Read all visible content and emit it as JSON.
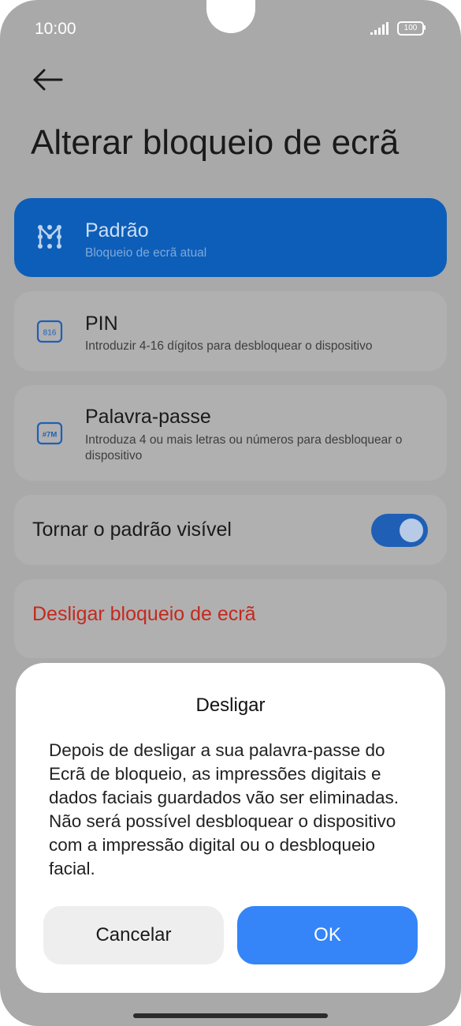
{
  "status_bar": {
    "time": "10:00",
    "battery": "100"
  },
  "page": {
    "title": "Alterar bloqueio de ecrã"
  },
  "options": [
    {
      "title": "Padrão",
      "subtitle": "Bloqueio de ecrã atual",
      "selected": true,
      "icon": "pattern-icon"
    },
    {
      "title": "PIN",
      "subtitle": "Introduzir 4-16 dígitos para desbloquear o dispositivo",
      "icon_text": "816",
      "icon": "pin-icon"
    },
    {
      "title": "Palavra-passe",
      "subtitle": "Introduza 4 ou mais letras ou números para desbloquear o dispositivo",
      "icon_text": "#7M",
      "icon": "password-icon"
    }
  ],
  "toggle_row": {
    "label": "Tornar o padrão visível",
    "on": true
  },
  "disable_row": {
    "label": "Desligar bloqueio de ecrã",
    "color": "#c4291f"
  },
  "dialog": {
    "title": "Desligar",
    "body": "Depois de desligar a sua palavra-passe do Ecrã de bloqueio, as impressões digitais e dados faciais guardados vão ser eliminadas. Não será possível desbloquear o dispositivo com a impressão digital ou o desbloqueio facial.",
    "cancel_label": "Cancelar",
    "ok_label": "OK"
  },
  "colors": {
    "accent": "#3585f8",
    "selected_card": "#0d5eb8",
    "danger": "#c4291f"
  }
}
